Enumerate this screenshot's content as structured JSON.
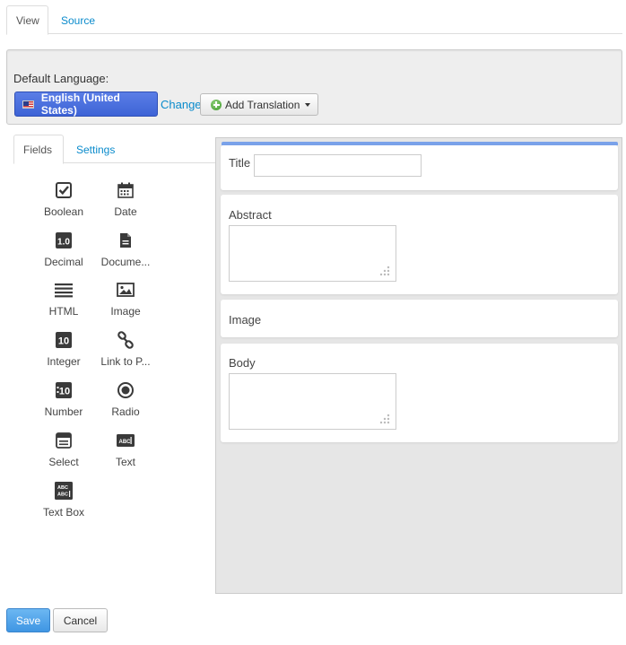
{
  "top_tabs": {
    "view": "View",
    "source": "Source"
  },
  "language": {
    "label": "Default Language:",
    "current": "English (United States)",
    "change_link": "Change",
    "add_translation": "Add Translation",
    "flag_icon": "us-flag-icon"
  },
  "toolbox": {
    "tabs": {
      "fields": "Fields",
      "settings": "Settings"
    },
    "fields": [
      {
        "label": "Boolean",
        "icon": "checkbox-icon"
      },
      {
        "label": "Date",
        "icon": "calendar-icon"
      },
      {
        "label": "Decimal",
        "icon": "decimal-icon"
      },
      {
        "label": "Docume...",
        "icon": "document-icon"
      },
      {
        "label": "HTML",
        "icon": "html-lines-icon"
      },
      {
        "label": "Image",
        "icon": "image-icon"
      },
      {
        "label": "Integer",
        "icon": "integer-icon"
      },
      {
        "label": "Link to P...",
        "icon": "link-icon"
      },
      {
        "label": "Number",
        "icon": "number-icon"
      },
      {
        "label": "Radio",
        "icon": "radio-icon"
      },
      {
        "label": "Select",
        "icon": "select-icon"
      },
      {
        "label": "Text",
        "icon": "text-icon"
      },
      {
        "label": "Text Box",
        "icon": "textbox-icon"
      }
    ]
  },
  "form": {
    "accent_color": "#7aa2ea",
    "fields": [
      {
        "label": "Title",
        "kind": "text"
      },
      {
        "label": "Abstract",
        "kind": "textarea"
      },
      {
        "label": "Image",
        "kind": "image"
      },
      {
        "label": "Body",
        "kind": "textarea"
      }
    ]
  },
  "actions": {
    "save": "Save",
    "cancel": "Cancel"
  },
  "colors": {
    "primary_button": "#3f96e3",
    "link": "#0a8bcc",
    "language_button": "#3d63d6"
  }
}
